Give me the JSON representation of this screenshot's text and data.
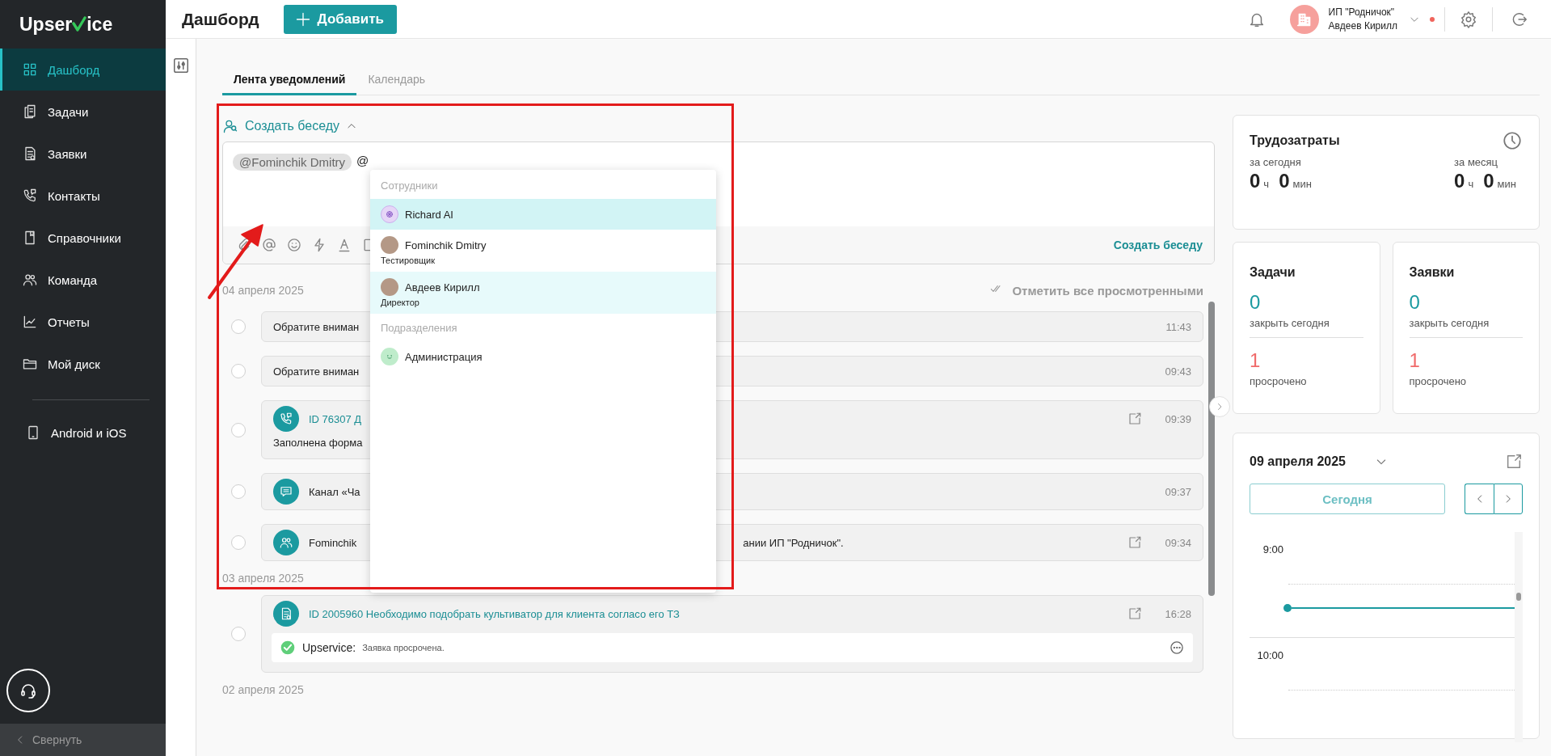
{
  "sidebar": {
    "logo": {
      "start": "Upser",
      "end": "ice"
    },
    "items": [
      {
        "label": "Дашборд",
        "selected": true
      },
      {
        "label": "Задачи",
        "selected": false
      },
      {
        "label": "Заявки",
        "selected": false
      },
      {
        "label": "Контакты",
        "selected": false
      },
      {
        "label": "Справочники",
        "selected": false
      },
      {
        "label": "Команда",
        "selected": false
      },
      {
        "label": "Отчеты",
        "selected": false
      },
      {
        "label": "Мой диск",
        "selected": false
      }
    ],
    "mobile_link": "Android и iOS",
    "collapse": "Свернуть"
  },
  "header": {
    "title": "Дашборд",
    "add_button": "Добавить",
    "account": {
      "company": "ИП \"Родничок\"",
      "user": "Авдеев Кирилл",
      "notification": true
    }
  },
  "tabs": [
    {
      "label": "Лента уведомлений",
      "selected": true
    },
    {
      "label": "Календарь",
      "selected": false
    }
  ],
  "composer": {
    "toggle": "Создать беседу",
    "expanded": true,
    "mention": "@Fominchik Dmitry",
    "typed": "@",
    "submit": "Создать беседу"
  },
  "mention_menu": {
    "sections": [
      {
        "title": "Сотрудники",
        "items": [
          {
            "name": "Richard AI",
            "kind": "bot",
            "selected": true,
            "hovered": false
          },
          {
            "name": "Fominchik Dmitry",
            "role": "Тестировщик",
            "kind": "person",
            "selected": false,
            "hovered": false
          },
          {
            "name": "Авдеев Кирилл",
            "role": "Директор",
            "kind": "person",
            "selected": false,
            "hovered": true
          }
        ]
      },
      {
        "title": "Подразделения",
        "items": [
          {
            "name": "Администрация",
            "kind": "department",
            "selected": false,
            "hovered": false
          }
        ]
      }
    ]
  },
  "feed": {
    "mark_all": "Отметить все просмотренными",
    "groups": [
      {
        "date": "04 апреля 2025",
        "items": [
          {
            "kind": "notice",
            "text": "Обратите вниман",
            "time": "11:43",
            "external": false
          },
          {
            "kind": "notice",
            "text": "Обратите вниман",
            "time": "09:43",
            "external": false
          },
          {
            "kind": "call",
            "title": "ID 76307 Д",
            "text": "Заполнена форма",
            "time": "09:39",
            "external": true
          },
          {
            "kind": "channel",
            "text": "Канал «Ча",
            "time": "09:37",
            "external": false
          },
          {
            "kind": "team",
            "text": "Fominchik",
            "text_end": "ании ИП \"Родничок\".",
            "time": "09:34",
            "external": true
          }
        ]
      },
      {
        "date": "03 апреля 2025",
        "items": [
          {
            "kind": "request",
            "title": "ID 2005960 Необходимо подобрать культиватор для клиента согласо его ТЗ",
            "time": "16:28",
            "external": true,
            "comment": {
              "author": "Upservice:",
              "text": "Заявка просрочена."
            }
          }
        ]
      },
      {
        "date": "02 апреля 2025"
      }
    ]
  },
  "widgets": {
    "labor": {
      "title": "Трудозатраты",
      "periods": [
        {
          "label": "за сегодня",
          "hours": "0",
          "h_unit": "ч",
          "minutes": "0",
          "m_unit": "мин"
        },
        {
          "label": "за месяц",
          "hours": "0",
          "h_unit": "ч",
          "minutes": "0",
          "m_unit": "мин"
        }
      ]
    },
    "counters": [
      {
        "title": "Задачи",
        "due": "0",
        "due_label": "закрыть сегодня",
        "overdue": "1",
        "overdue_label": "просрочено"
      },
      {
        "title": "Заявки",
        "due": "0",
        "due_label": "закрыть сегодня",
        "overdue": "1",
        "overdue_label": "просрочено"
      }
    ],
    "calendar": {
      "date": "09 апреля 2025",
      "today_button": "Сегодня",
      "times": [
        "9:00",
        "10:00"
      ]
    }
  }
}
